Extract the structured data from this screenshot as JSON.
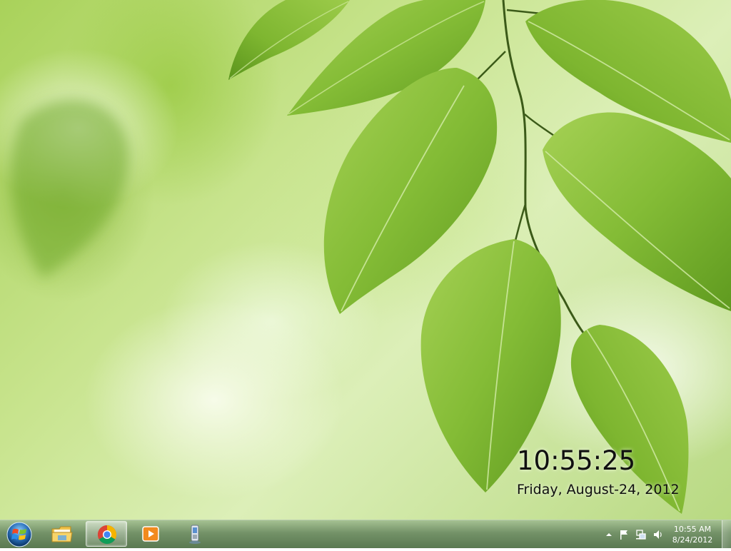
{
  "desktop": {
    "wallpaper": "green-leaves"
  },
  "clock_gadget": {
    "time": "10:55:25",
    "date": "Friday, August-24, 2012"
  },
  "taskbar": {
    "start_icon": "windows-start-orb",
    "pinned": [
      {
        "icon": "folder-icon",
        "active": false
      },
      {
        "icon": "chrome-icon",
        "active": true
      },
      {
        "icon": "media-player-icon",
        "active": false
      },
      {
        "icon": "mobile-device-icon",
        "active": false
      }
    ],
    "tray": {
      "icons": [
        "show-hidden-icons-arrow",
        "action-center-flag-icon",
        "network-icon",
        "volume-icon"
      ],
      "time": "10:55 AM",
      "date": "8/24/2012"
    }
  },
  "colors": {
    "leaf_dark": "#5e9a1e",
    "leaf_light": "#9acb4a",
    "taskbar_tint": "#6c8c60"
  }
}
